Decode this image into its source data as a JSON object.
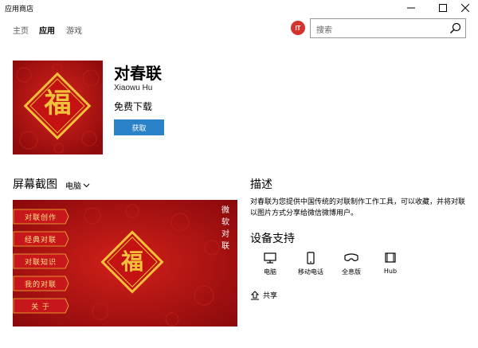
{
  "window": {
    "title": "应用商店"
  },
  "nav": {
    "tabs": [
      {
        "label": "主页"
      },
      {
        "label": "应用"
      },
      {
        "label": "游戏"
      }
    ]
  },
  "user_badge": "IT",
  "search": {
    "placeholder": "搜索"
  },
  "app": {
    "name": "对春联",
    "developer": "Xiaowu Hu",
    "price": "免费下载",
    "get_button": "获取",
    "icon_char": "福"
  },
  "screenshots": {
    "heading": "屏幕截图",
    "device": "电脑",
    "menu": [
      "对联创作",
      "经典对联",
      "对联知识",
      "我的对联",
      "关 于"
    ],
    "title_vertical": [
      "微",
      "软",
      "对",
      "联"
    ],
    "center_char": "福"
  },
  "description": {
    "heading": "描述",
    "text": "对春联为您提供中国传统的对联制作工作工具，可以收藏，并将对联以图片方式分享给微信微博用户。"
  },
  "devices": {
    "heading": "设备支持",
    "items": [
      {
        "label": "电脑",
        "icon": "pc-icon"
      },
      {
        "label": "移动电话",
        "icon": "phone-icon"
      },
      {
        "label": "全息版",
        "icon": "holographic-icon"
      },
      {
        "label": "Hub",
        "icon": "hub-icon"
      }
    ]
  },
  "share": {
    "label": "共享"
  },
  "colors": {
    "accent": "#2a82c9",
    "festive_red": "#b10d12",
    "gold": "#f2c03a",
    "badge": "#d3322d"
  }
}
